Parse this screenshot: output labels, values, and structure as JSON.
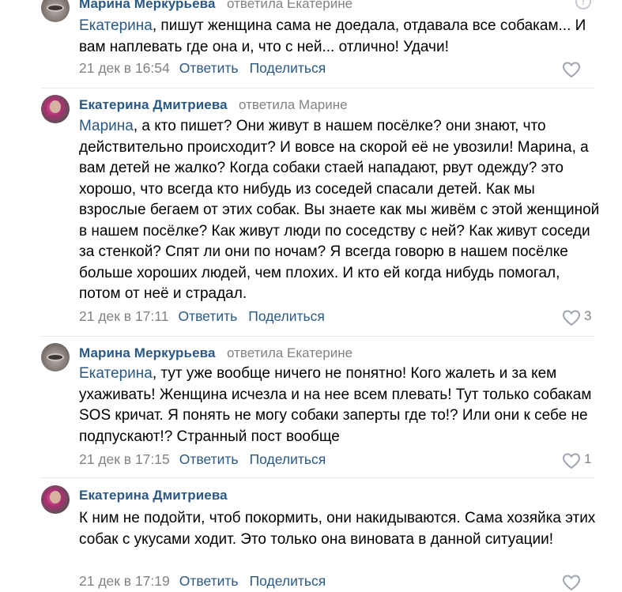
{
  "comments": [
    {
      "author": "Марина Меркурьева",
      "replied": "ответила Екатерине",
      "mention": "Екатерина",
      "text": ", пишут женщина сама не доедала, отдавала все собакам... И вам наплевать где она и, что с ней... отлично! Удачи!",
      "date": "21 дек в 16:54",
      "reply_label": "Ответить",
      "share_label": "Поделиться",
      "likes": ""
    },
    {
      "author": "Екатерина Дмитриева",
      "replied": "ответила Марине",
      "mention": "Марина",
      "text": ", а кто пишет? Они живут в нашем посёлке? они знают, что действительно происходит? И вовсе на скорой её не увозили! Марина, а вам детей не жалко? Когда собаки стаей нападают, рвут одежду? это хорошо, что всегда кто нибудь из соседей спасали детей. Как мы взрослые бегаем от этих собак. Вы знаете как мы живём с этой женщиной в нашем посёлке? Как живут люди по соседству с ней? Как живут соседи за стенкой? Спят ли они по ночам? Я всегда говорю в нашем посёлке больше хороших людей, чем плохих. И кто ей когда нибудь помогал, потом от неё и страдал.",
      "date": "21 дек в 17:11",
      "reply_label": "Ответить",
      "share_label": "Поделиться",
      "likes": "3"
    },
    {
      "author": "Марина Меркурьева",
      "replied": "ответила Екатерине",
      "mention": "Екатерина",
      "text": ", тут уже вообще ничего не понятно! Кого жалеть и за кем ухаживать! Женщина исчезла и на нее всем плевать! Тут только собакам SOS кричат. Я понять не могу собаки заперты где то!? Или они к себе не подпускают!? Странный пост вообще",
      "date": "21 дек в 17:15",
      "reply_label": "Ответить",
      "share_label": "Поделиться",
      "likes": "1"
    },
    {
      "author": "Екатерина Дмитриева",
      "replied": "",
      "mention": "",
      "text": "К ним не подойти, чтоб покормить, они накидываются. Сама хозяйка этих собак с укусами ходит. Это только она виновата в данной ситуации!",
      "date": "21 дек в 17:19",
      "reply_label": "Ответить",
      "share_label": "Поделиться",
      "likes": ""
    }
  ],
  "icons": {
    "like": "heart-outline-icon",
    "report": "exclamation-circle-icon"
  },
  "colors": {
    "link": "#2a5885",
    "muted": "#828282",
    "separator": "#e7e8ec"
  }
}
